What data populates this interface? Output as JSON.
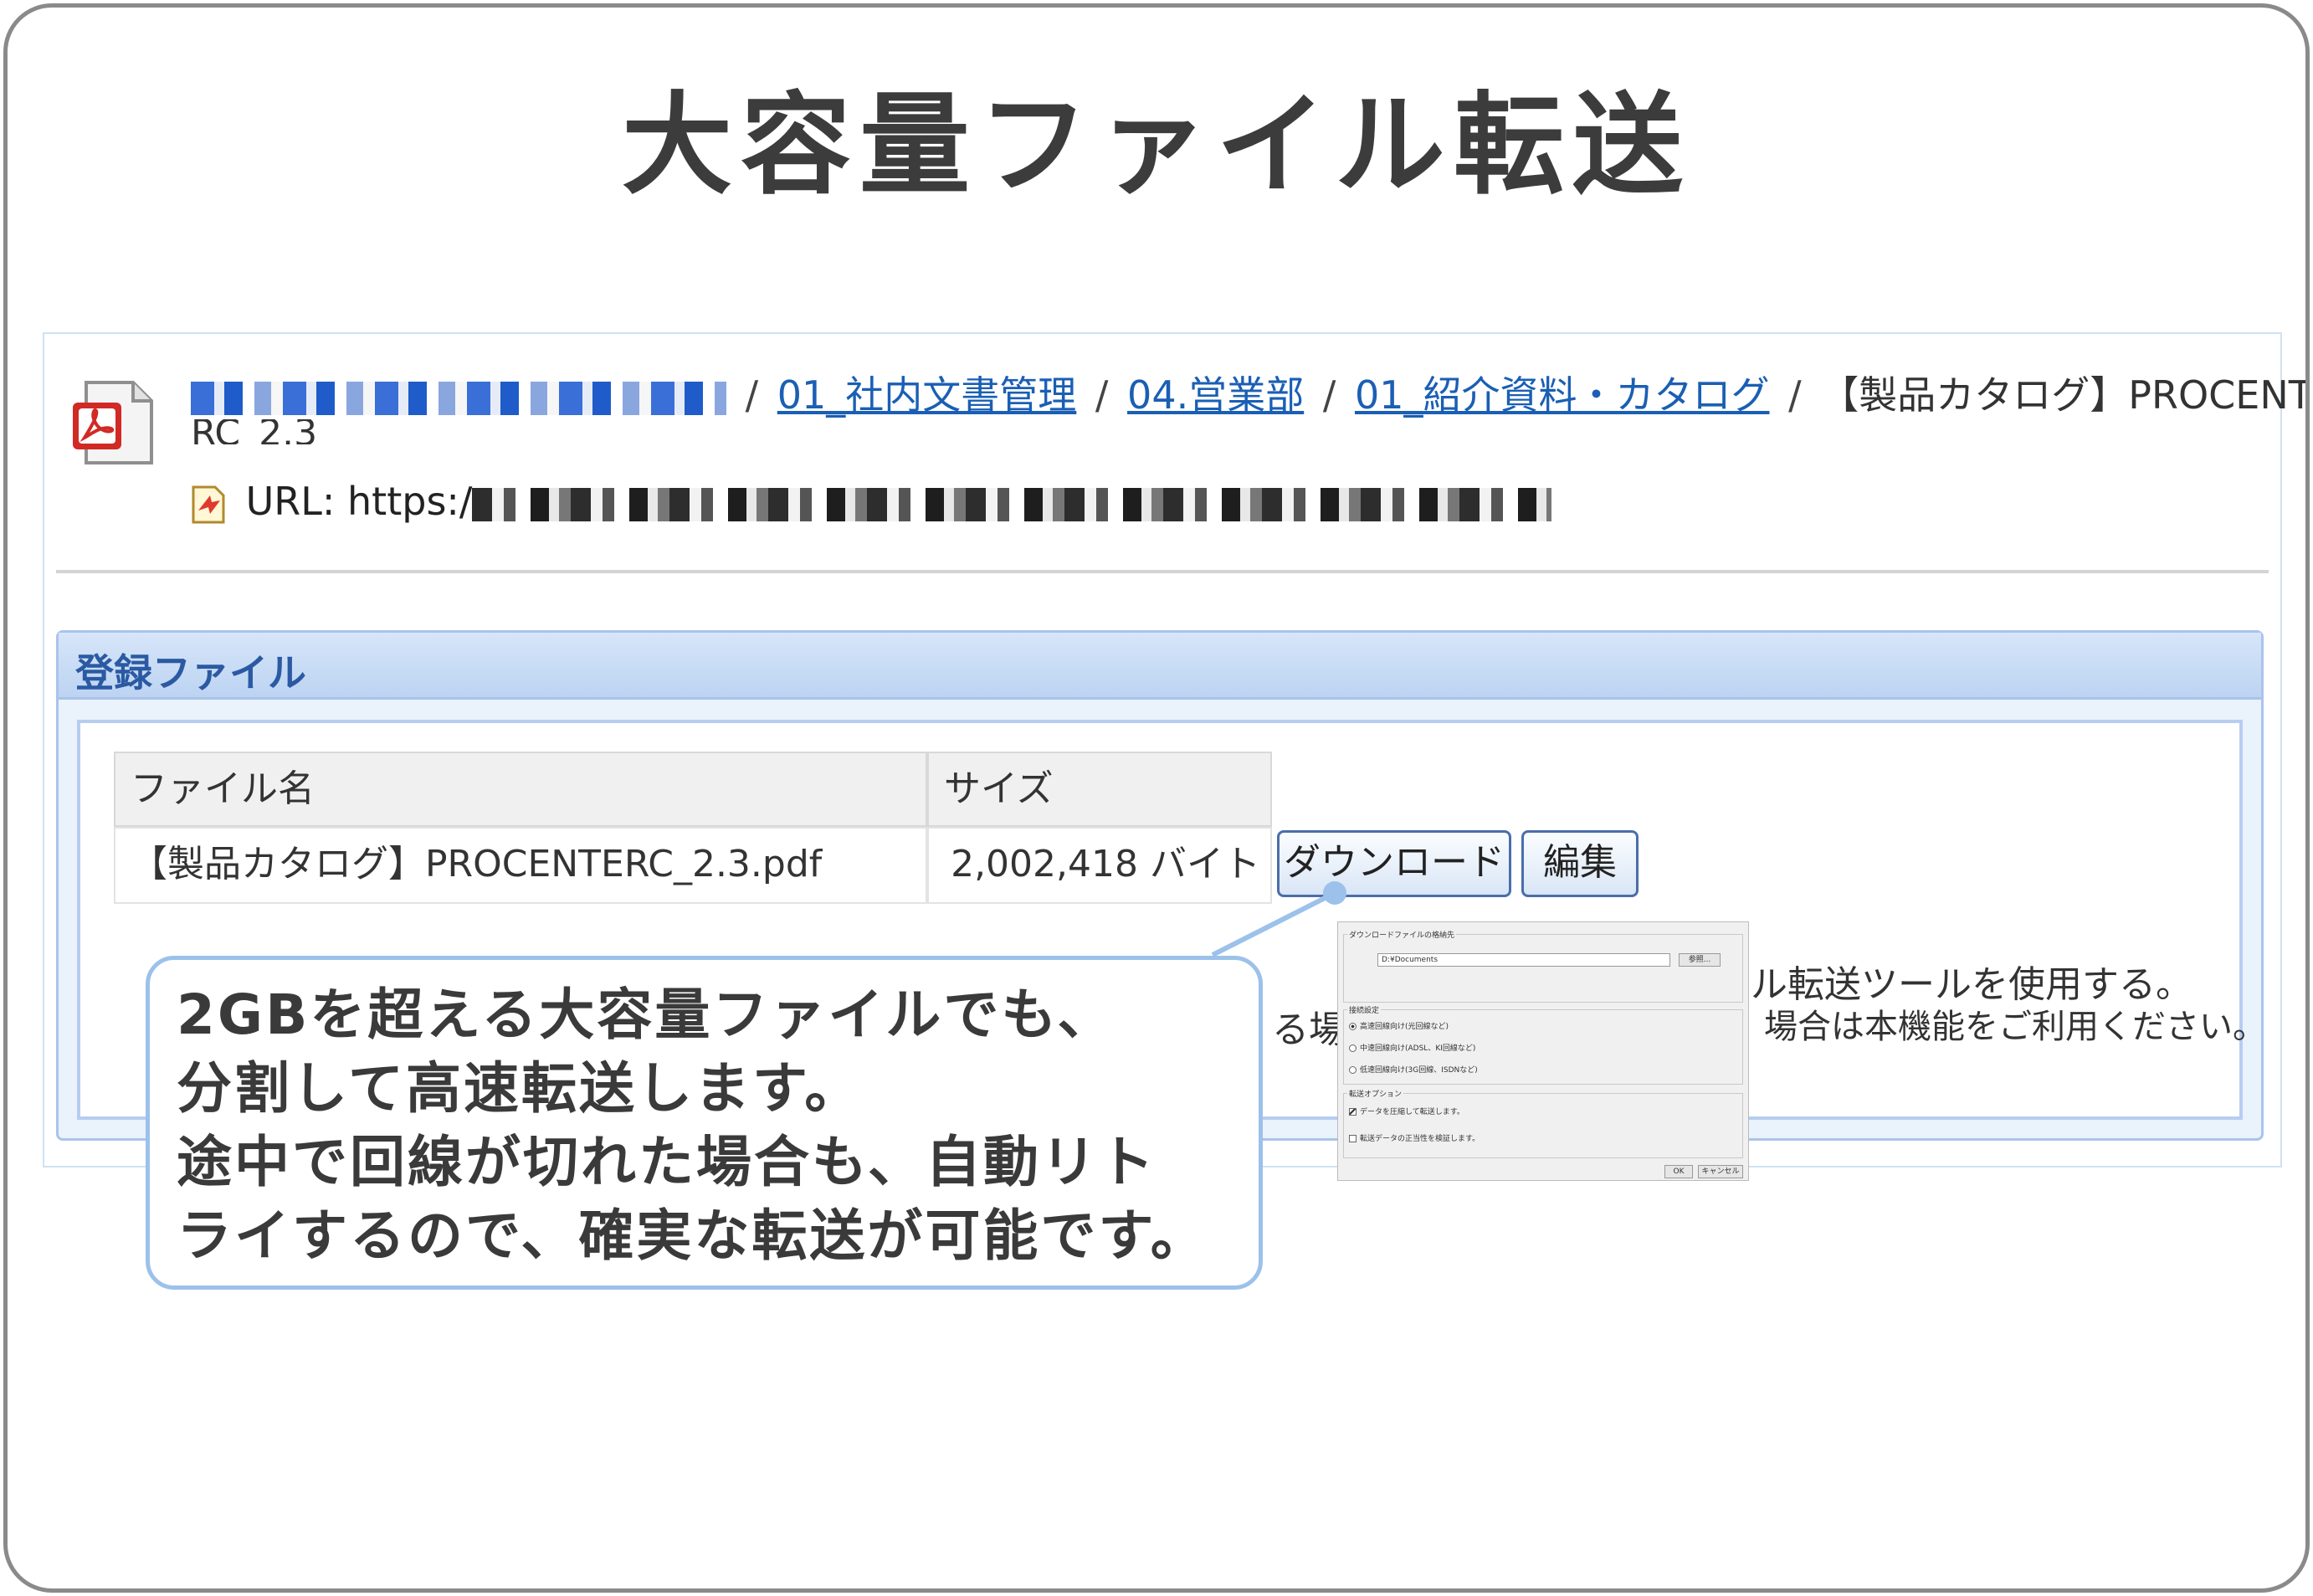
{
  "title": "大容量ファイル転送",
  "breadcrumb": {
    "items": [
      "01_社内文書管理",
      "04.営業部",
      "01_紹介資料・カタログ"
    ],
    "separator": "/",
    "current": "【製品カタログ】PROCENTE",
    "current_wrap": "RC_2.3"
  },
  "url": {
    "label": "URL:",
    "prefix": "https:/"
  },
  "files_panel": {
    "title": "登録ファイル",
    "columns": [
      "ファイル名",
      "サイズ"
    ],
    "rows": [
      {
        "name": "【製品カタログ】PROCENTERC_2.3.pdf",
        "size": "2,002,418 バイト"
      }
    ],
    "download_label": "ダウンロード",
    "edit_label": "編集",
    "behind_text_1": "ル転送ツールを使用する。",
    "behind_text_2": "る場合",
    "behind_text_3": "場合は本機能をご利用ください。"
  },
  "dialog": {
    "group_dest": "ダウンロードファイルの格納先",
    "path_value": "D:¥Documents",
    "browse_label": "参照...",
    "group_line": "接続設定",
    "radio_options": [
      "高速回線向け(光回線など)",
      "中速回線向け(ADSL、KI回線など)",
      "低速回線向け(3G回線、ISDNなど)"
    ],
    "group_options": "転送オプション",
    "check_options": [
      "データを圧縮して転送します。",
      "転送データの正当性を検証します。"
    ],
    "ok_label": "OK",
    "cancel_label": "キャンセル"
  },
  "callout": {
    "line1": "2GBを超える大容量ファイルでも、",
    "line2": "分割して高速転送します。",
    "line3": "途中で回線が切れた場合も、自動リト",
    "line4": "ライするので、確実な転送が可能です。"
  },
  "colors": {
    "link": "#1a5fb4",
    "callout_border": "#9cc1ea",
    "panel_title": "#2b5aa3",
    "pdf_red": "#d12a25"
  }
}
